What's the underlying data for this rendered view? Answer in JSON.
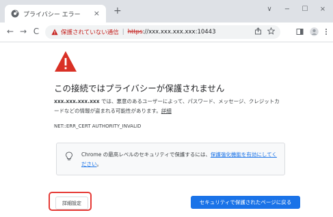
{
  "tab": {
    "title": "プライバシー エラー",
    "close": "×",
    "new_tab": "+"
  },
  "window_controls": {
    "dropdown": "∨",
    "minimize": "−",
    "maximize": "☐",
    "close": "×"
  },
  "toolbar": {
    "back": "←",
    "forward": "→",
    "reload": "C",
    "security_label": "保護されていない通信",
    "separator": "|",
    "url_scheme": "https",
    "url_rest": "://xxx.xxx.xxx.xxx:10443"
  },
  "page": {
    "heading": "この接続ではプライバシーが保護されません",
    "host": "xxx.xxx.xxx.xxx",
    "body": " では、悪意のあるユーザーによって、パスワード、メッセージ、クレジットカードなどの情報が盗まれる可能性があります。",
    "details_link": "詳細",
    "error_code": "NET::ERR_CERT AUTHORITY_INVALID",
    "info_text": "Chrome の最高レベルのセキュリティで保護するには、",
    "info_link": "保護強化機能を有効にしてください",
    "info_end": "。",
    "advanced_button": "詳細設定",
    "back_button": "セキュリティで保護されたページに戻る"
  },
  "colors": {
    "accent": "#1a73e8",
    "warning": "#c5221f",
    "highlight": "#e53935"
  }
}
